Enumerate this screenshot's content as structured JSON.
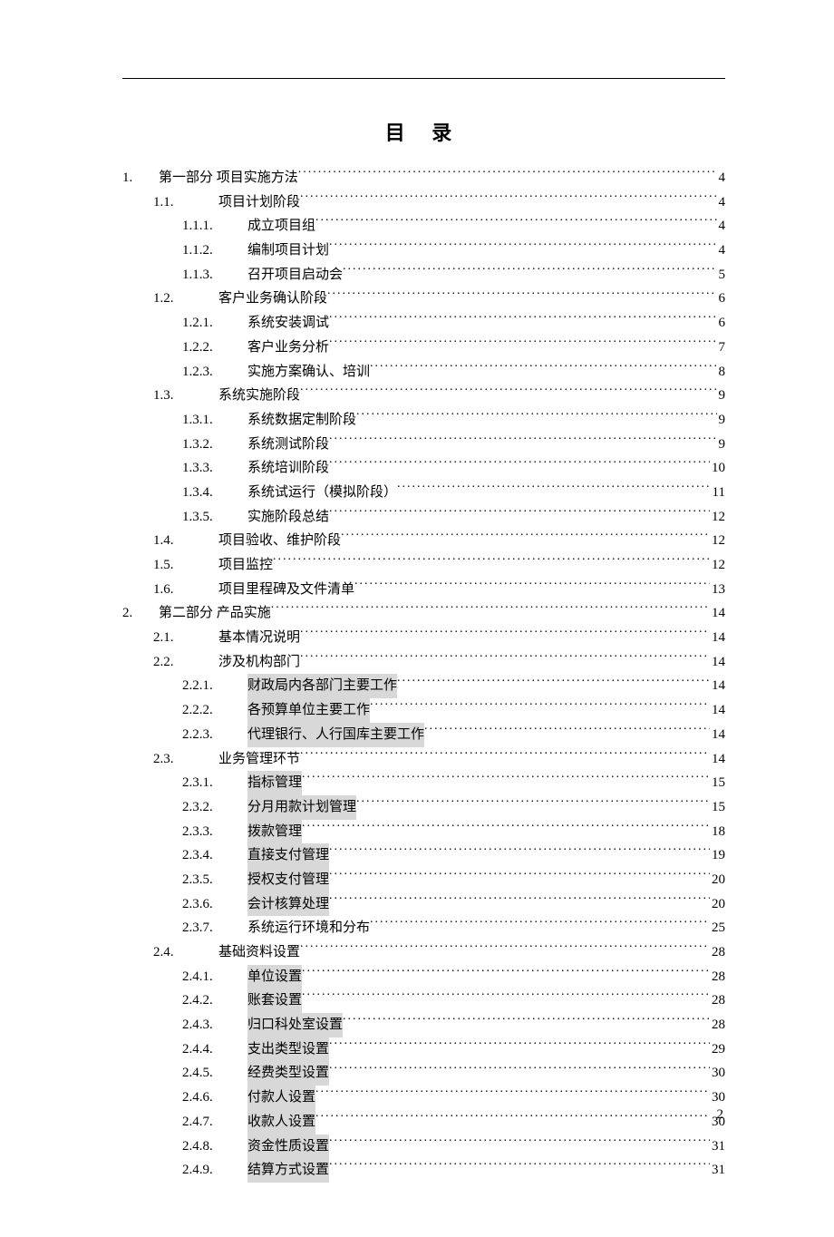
{
  "toc_title": "目 录",
  "footer_page": "2",
  "entries": [
    {
      "level": 1,
      "num": "1.",
      "title": "第一部分 项目实施方法",
      "page": "4",
      "hl": false
    },
    {
      "level": 2,
      "num": "1.1.",
      "title": "项目计划阶段",
      "page": "4",
      "hl": false
    },
    {
      "level": 3,
      "num": "1.1.1.",
      "title": "成立项目组",
      "page": "4",
      "hl": false
    },
    {
      "level": 3,
      "num": "1.1.2.",
      "title": "编制项目计划",
      "page": "4",
      "hl": false
    },
    {
      "level": 3,
      "num": "1.1.3.",
      "title": "召开项目启动会",
      "page": "5",
      "hl": false
    },
    {
      "level": 2,
      "num": "1.2.",
      "title": "客户业务确认阶段",
      "page": "6",
      "hl": false
    },
    {
      "level": 3,
      "num": "1.2.1.",
      "title": "系统安装调试",
      "page": "6",
      "hl": false
    },
    {
      "level": 3,
      "num": "1.2.2.",
      "title": "客户业务分析",
      "page": "7",
      "hl": false
    },
    {
      "level": 3,
      "num": "1.2.3.",
      "title": "实施方案确认、培训",
      "page": "8",
      "hl": false
    },
    {
      "level": 2,
      "num": "1.3.",
      "title": "系统实施阶段",
      "page": "9",
      "hl": false
    },
    {
      "level": 3,
      "num": "1.3.1.",
      "title": "系统数据定制阶段",
      "page": "9",
      "hl": false
    },
    {
      "level": 3,
      "num": "1.3.2.",
      "title": "系统测试阶段",
      "page": "9",
      "hl": false
    },
    {
      "level": 3,
      "num": "1.3.3.",
      "title": "系统培训阶段",
      "page": "10",
      "hl": false
    },
    {
      "level": 3,
      "num": "1.3.4.",
      "title": "系统试运行（模拟阶段）",
      "page": "11",
      "hl": false
    },
    {
      "level": 3,
      "num": "1.3.5.",
      "title": "实施阶段总结",
      "page": "12",
      "hl": false
    },
    {
      "level": 2,
      "num": "1.4.",
      "title": "项目验收、维护阶段",
      "page": "12",
      "hl": false
    },
    {
      "level": 2,
      "num": "1.5.",
      "title": "项目监控",
      "page": "12",
      "hl": false
    },
    {
      "level": 2,
      "num": "1.6.",
      "title": "项目里程碑及文件清单",
      "page": "13",
      "hl": false
    },
    {
      "level": 1,
      "num": "2.",
      "title": "第二部分 产品实施",
      "page": "14",
      "hl": false
    },
    {
      "level": 2,
      "num": "2.1.",
      "title": "基本情况说明",
      "page": "14",
      "hl": false
    },
    {
      "level": 2,
      "num": "2.2.",
      "title": "涉及机构部门",
      "page": "14",
      "hl": false
    },
    {
      "level": 3,
      "num": "2.2.1.",
      "title": "财政局内各部门主要工作",
      "page": "14",
      "hl": true
    },
    {
      "level": 3,
      "num": "2.2.2.",
      "title": "各预算单位主要工作",
      "page": "14",
      "hl": true
    },
    {
      "level": 3,
      "num": "2.2.3.",
      "title": "代理银行、人行国库主要工作",
      "page": "14",
      "hl": true
    },
    {
      "level": 2,
      "num": "2.3.",
      "title": "业务管理环节",
      "page": "14",
      "hl": false
    },
    {
      "level": 3,
      "num": "2.3.1.",
      "title": "指标管理",
      "page": "15",
      "hl": true
    },
    {
      "level": 3,
      "num": "2.3.2.",
      "title": "分月用款计划管理",
      "page": "15",
      "hl": true
    },
    {
      "level": 3,
      "num": "2.3.3.",
      "title": "拨款管理",
      "page": "18",
      "hl": true
    },
    {
      "level": 3,
      "num": "2.3.4.",
      "title": "直接支付管理",
      "page": "19",
      "hl": true
    },
    {
      "level": 3,
      "num": "2.3.5.",
      "title": "授权支付管理",
      "page": "20",
      "hl": true
    },
    {
      "level": 3,
      "num": "2.3.6.",
      "title": "会计核算处理",
      "page": "20",
      "hl": true
    },
    {
      "level": 3,
      "num": "2.3.7.",
      "title": "系统运行环境和分布",
      "page": "25",
      "hl": false
    },
    {
      "level": 2,
      "num": "2.4.",
      "title": "基础资料设置",
      "page": "28",
      "hl": false
    },
    {
      "level": 3,
      "num": "2.4.1.",
      "title": "单位设置",
      "page": "28",
      "hl": true
    },
    {
      "level": 3,
      "num": "2.4.2.",
      "title": "账套设置",
      "page": "28",
      "hl": true
    },
    {
      "level": 3,
      "num": "2.4.3.",
      "title": "归口科处室设置",
      "page": "28",
      "hl": true
    },
    {
      "level": 3,
      "num": "2.4.4.",
      "title": "支出类型设置",
      "page": "29",
      "hl": true
    },
    {
      "level": 3,
      "num": "2.4.5.",
      "title": "经费类型设置",
      "page": "30",
      "hl": true
    },
    {
      "level": 3,
      "num": "2.4.6.",
      "title": "付款人设置",
      "page": "30",
      "hl": true
    },
    {
      "level": 3,
      "num": "2.4.7.",
      "title": "收款人设置",
      "page": "30",
      "hl": true
    },
    {
      "level": 3,
      "num": "2.4.8.",
      "title": "资金性质设置",
      "page": "31",
      "hl": true
    },
    {
      "level": 3,
      "num": "2.4.9.",
      "title": "结算方式设置",
      "page": "31",
      "hl": true
    }
  ]
}
